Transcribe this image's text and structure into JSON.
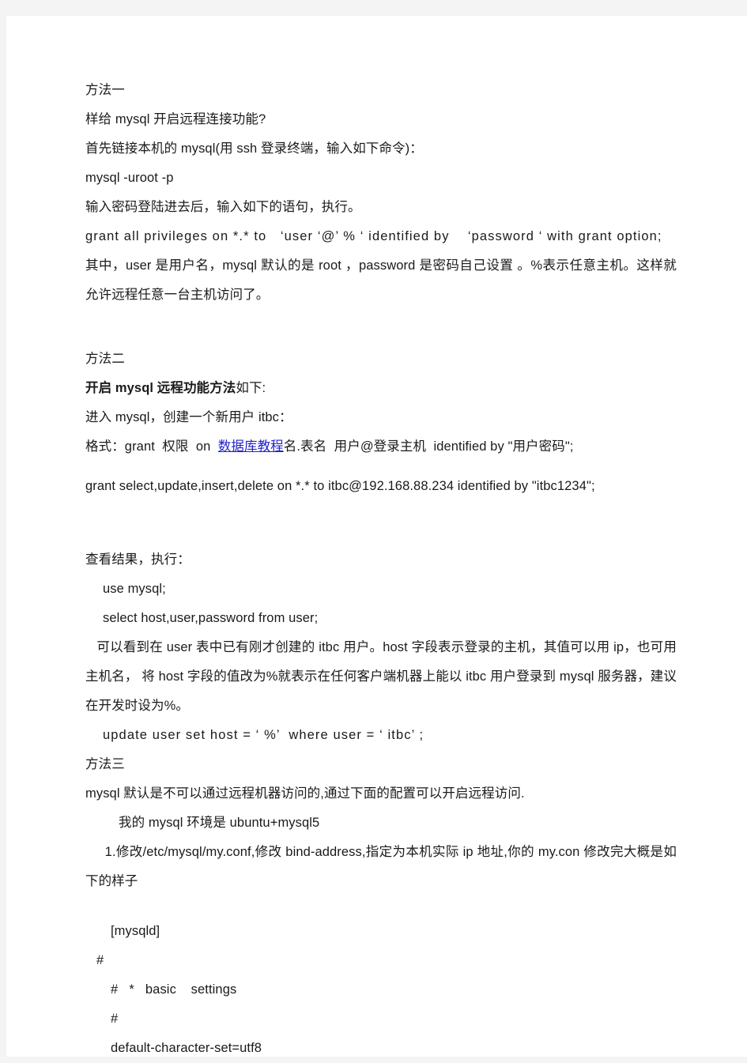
{
  "document": {
    "background_color": "#f4f4f4",
    "page_color": "#ffffff",
    "text_color": "#1a1a1a",
    "link_color": "#2222cc"
  },
  "blocks": {
    "method_one_heading": "方法一",
    "line_how_to_open": "样给 mysql 开启远程连接功能?",
    "line_connect_local": "首先链接本机的 mysql(用 ssh 登录终端，输入如下命令)：",
    "cmd_mysql_uroot": "mysql -uroot -p",
    "line_after_password": "输入密码登陆进去后，输入如下的语句，执行。",
    "cmd_grant_all": "grant all privileges on *.* to　‘user ‘@’ % ‘ identified by 　‘password ‘ with grant option;",
    "para_explain_one": "其中，user 是用户名，mysql 默认的是 root ，password 是密码自己设置 。%表示任意主机。这样就允许远程任意一台主机访问了。",
    "method_two_heading": "方法二",
    "subheading_bold": "开启 mysql 远程功能方法",
    "subheading_tail": "如下:",
    "line_enter_mysql": "进入 mysql，创建一个新用户 itbc：",
    "format_prefix": "格式：grant  权限  on  ",
    "format_link": "数据库教程",
    "format_suffix": "名.表名  用户@登录主机  identified by \"用户密码\";",
    "cmd_grant_select": "grant select,update,insert,delete on *.* to itbc@192.168.88.234 identified by \"itbc1234\";",
    "line_view_result": "查看结果，执行：",
    "cmd_use_mysql": "use mysql;",
    "cmd_select_host": "select host,user,password from user;",
    "para_explain_two": "可以看到在 user 表中已有刚才创建的 itbc 用户。host 字段表示登录的主机，其值可以用 ip，也可用主机名， 将 host 字段的值改为%就表示在任何客户端机器上能以 itbc 用户登录到 mysql 服务器，建议在开发时设为%。",
    "cmd_update_user": "update user set host = ‘ %’  where user = ‘ itbc’ ;",
    "method_three_heading": "方法三",
    "line_default_remote": "mysql 默认是不可以通过远程机器访问的,通过下面的配置可以开启远程访问.",
    "line_environment": "我的 mysql 环境是 ubuntu+mysql5",
    "para_step_one": "1.修改/etc/mysql/my.conf,修改 bind-address,指定为本机实际 ip 地址,你的 my.con 修改完大概是如下的样子",
    "cfg_mysqld": "[mysqld]",
    "cfg_hash_1": "#",
    "cfg_basic_settings": "#   *   basic    settings",
    "cfg_hash_2": "#",
    "cfg_charset": "default-character-set=utf8"
  }
}
